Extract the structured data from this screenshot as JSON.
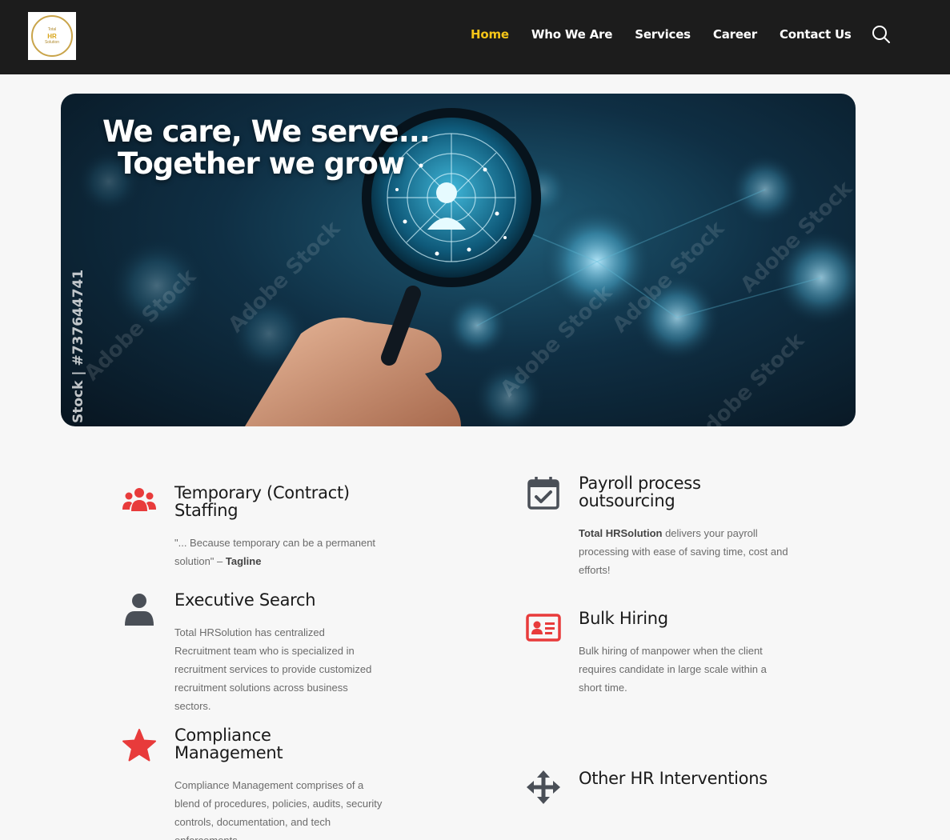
{
  "header": {
    "logo_text_top": "Total",
    "logo_mark": "HR",
    "logo_text_bottom": "Solution",
    "nav": [
      {
        "label": "Home",
        "active": true
      },
      {
        "label": "Who We Are",
        "active": false
      },
      {
        "label": "Services",
        "active": false
      },
      {
        "label": "Career",
        "active": false
      },
      {
        "label": "Contact Us",
        "active": false
      }
    ],
    "search_icon": "search-icon",
    "active_color": "#f5c518"
  },
  "hero": {
    "title_line1": "We care, We serve...",
    "title_line2": "Together we grow",
    "stock_id": "Stock | #737644741",
    "watermark": "Adobe Stock"
  },
  "services": {
    "temporary": {
      "icon": "users-icon",
      "title": "Temporary (Contract) Staffing",
      "quote": "\"... Because temporary can be a permanent solution\" – ",
      "quote_tag": "Tagline"
    },
    "payroll": {
      "icon": "calendar-check-icon",
      "title": "Payroll process outsourcing",
      "desc_bold": "Total HRSolution",
      "desc": " delivers your payroll processing with ease of saving time, cost and efforts!"
    },
    "executive": {
      "icon": "user-icon",
      "title": "Executive Search",
      "desc": "Total HRSolution has centralized Recruitment team who is specialized in recruitment services to provide customized recruitment solutions across business sectors."
    },
    "bulk": {
      "icon": "id-card-icon",
      "title": "Bulk Hiring",
      "desc": "Bulk hiring of manpower when the client requires candidate in large scale within a short time."
    },
    "compliance": {
      "icon": "star-icon",
      "title": "Compliance Management",
      "desc": "Compliance Management comprises of a blend of procedures, policies, audits, security controls, documentation, and tech enforcements."
    },
    "other": {
      "icon": "move-arrows-icon",
      "title": "Other HR Interventions"
    }
  },
  "colors": {
    "accent_red": "#e83b3b",
    "icon_gray": "#4a4f57",
    "header_bg": "#1c1c1c"
  }
}
